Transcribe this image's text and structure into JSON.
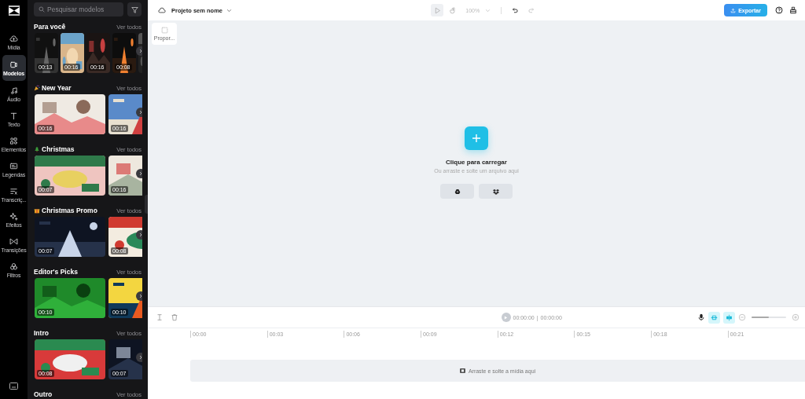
{
  "nav": [
    {
      "label": "Mídia",
      "selected": false
    },
    {
      "label": "Modelos",
      "selected": true
    },
    {
      "label": "Áudio",
      "selected": false
    },
    {
      "label": "Texto",
      "selected": false
    },
    {
      "label": "Elementos",
      "selected": false
    },
    {
      "label": "Legendas",
      "selected": false
    },
    {
      "label": "Transcriç...",
      "selected": false
    },
    {
      "label": "Efeitos",
      "selected": false
    },
    {
      "label": "Transições",
      "selected": false
    },
    {
      "label": "Filtros",
      "selected": false
    }
  ],
  "search": {
    "placeholder": "Pesquisar modelos"
  },
  "sections": [
    {
      "title": "Para você",
      "link": "Ver todos",
      "thumbs": [
        {
          "kind": "picture",
          "duration": "00:13"
        },
        {
          "kind": "picture",
          "duration": "00:16"
        },
        {
          "kind": "picture",
          "duration": "00:16"
        },
        {
          "kind": "picture",
          "duration": "00:08"
        },
        {
          "kind": "picture"
        }
      ]
    },
    {
      "title": "New Year",
      "link": "Ver todos",
      "thumbs": [
        {
          "kind": "picture",
          "duration": "00:16"
        },
        {
          "kind": "picture",
          "duration": "00:16"
        }
      ]
    },
    {
      "title": "Christmas",
      "link": "Ver todos",
      "thumbs": [
        {
          "kind": "picture",
          "duration": "00:07"
        },
        {
          "kind": "picture",
          "duration": "00:16"
        }
      ]
    },
    {
      "title": "Christmas Promo",
      "link": "Ver todos",
      "thumbs": [
        {
          "kind": "picture",
          "duration": "00:07"
        },
        {
          "kind": "picture",
          "duration": "00:08"
        }
      ]
    },
    {
      "title": "Editor's Picks",
      "link": "Ver todos",
      "thumbs": [
        {
          "kind": "picture",
          "duration": "00:10"
        },
        {
          "kind": "picture",
          "duration": "00:10"
        }
      ]
    },
    {
      "title": "Intro",
      "link": "Ver todos",
      "thumbs": [
        {
          "kind": "picture",
          "duration": "00:08"
        },
        {
          "kind": "picture",
          "duration": "00:07"
        }
      ]
    },
    {
      "title": "Outro",
      "link": "Ver todos"
    }
  ],
  "topbar": {
    "project": "Projeto sem nome",
    "tools": [
      {
        "selected": true
      },
      {
        "selected": false
      }
    ],
    "zoom": {
      "value": "100%",
      "disabled": true
    },
    "undo": {
      "disabled": false
    },
    "redo": {
      "disabled": true
    },
    "export": "Exportar"
  },
  "canvas": {
    "ratio": "Propor...",
    "title": "Clique para carregar",
    "subtitle": "Ou arraste e solte um arquivo aqui"
  },
  "timeline": {
    "time": "00:00:00",
    "separator": "|",
    "total": "00:00:00",
    "toggles": [
      {
        "on": true
      },
      {
        "on": true
      }
    ],
    "zoom_slider": {
      "level": 0.5
    },
    "ruler": [
      "00:00",
      "00:03",
      "00:06",
      "00:09",
      "00:12",
      "00:15",
      "00:18",
      "00:21"
    ],
    "drop": "Arraste e solte a mídia aqui"
  }
}
